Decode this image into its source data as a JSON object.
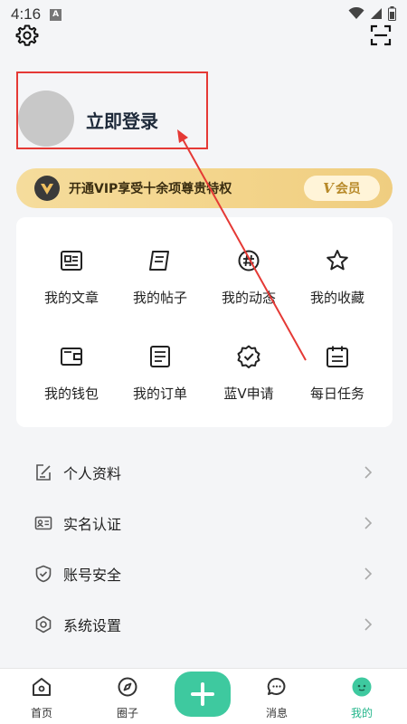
{
  "status_bar": {
    "time": "4:16",
    "notif_badge": "A"
  },
  "profile": {
    "login_text": "立即登录"
  },
  "vip": {
    "text": "开通VIP享受十余项尊贵特权",
    "badge_v": "V",
    "badge_label": "会员"
  },
  "grid": {
    "items": [
      {
        "label": "我的文章",
        "icon": "article-icon"
      },
      {
        "label": "我的帖子",
        "icon": "post-icon"
      },
      {
        "label": "我的动态",
        "icon": "activity-icon"
      },
      {
        "label": "我的收藏",
        "icon": "star-icon"
      },
      {
        "label": "我的钱包",
        "icon": "wallet-icon"
      },
      {
        "label": "我的订单",
        "icon": "order-icon"
      },
      {
        "label": "蓝V申请",
        "icon": "verified-badge-icon"
      },
      {
        "label": "每日任务",
        "icon": "calendar-icon"
      }
    ]
  },
  "menu": {
    "items": [
      {
        "label": "个人资料",
        "icon": "edit-profile-icon"
      },
      {
        "label": "实名认证",
        "icon": "id-card-icon"
      },
      {
        "label": "账号安全",
        "icon": "shield-icon"
      },
      {
        "label": "系统设置",
        "icon": "settings-hex-icon"
      }
    ]
  },
  "bottom_nav": {
    "items": [
      {
        "label": "首页",
        "icon": "home-icon"
      },
      {
        "label": "圈子",
        "icon": "compass-icon"
      },
      {
        "label": "消息",
        "icon": "message-icon"
      },
      {
        "label": "我的",
        "icon": "profile-face-icon"
      }
    ],
    "active": "我的"
  },
  "colors": {
    "accent": "#3ec99f",
    "annotation": "#e53935",
    "vip_gold": "#f3d48a"
  }
}
